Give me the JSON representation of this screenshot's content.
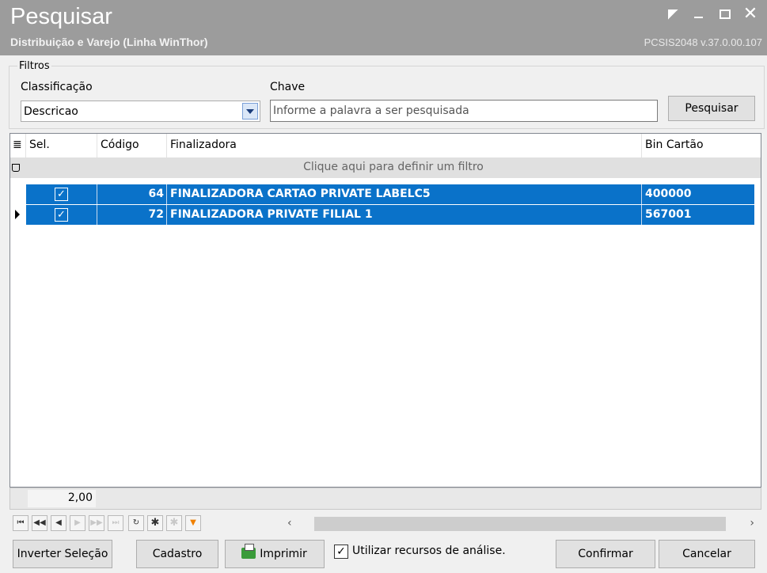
{
  "window": {
    "title": "Pesquisar",
    "subtitle": "Distribuição e Varejo (Linha WinThor)",
    "version": "PCSIS2048  v.37.0.00.107",
    "controls": [
      "restore-icon",
      "minimize-icon",
      "maximize-icon",
      "close-icon"
    ]
  },
  "filters": {
    "legend": "Filtros",
    "classificacao_label": "Classificação",
    "classificacao_value": "Descricao",
    "chave_label": "Chave",
    "chave_placeholder": "Informe a palavra a ser pesquisada",
    "search_button": "Pesquisar"
  },
  "grid": {
    "columns": [
      "Sel.",
      "Código",
      "Finalizadora",
      "Bin Cartão"
    ],
    "filter_hint": "Clique aqui para definir um filtro",
    "rows": [
      {
        "selected": true,
        "codigo": "64",
        "finalizadora": "FINALIZADORA CARTAO PRIVATE LABELC5",
        "bin": "400000",
        "current": false
      },
      {
        "selected": true,
        "codigo": "72",
        "finalizadora": "FINALIZADORA PRIVATE FILIAL 1",
        "bin": "567001",
        "current": true
      }
    ],
    "summary_value": "2,00"
  },
  "navigator": {
    "buttons": [
      "first-icon",
      "prev-page-icon",
      "prev-icon",
      "next-icon",
      "next-page-icon",
      "last-icon",
      "refresh-icon",
      "insert-icon",
      "delete-icon",
      "filter-icon"
    ]
  },
  "footer": {
    "invert_button": "Inverter Seleção",
    "cadastro_button": "Cadastro",
    "imprimir_button": "Imprimir",
    "analysis_label": "Utilizar recursos de análise.",
    "analysis_checked": true,
    "confirm_button": "Confirmar",
    "cancel_button": "Cancelar"
  },
  "colors": {
    "titlebar": "#9c9c9c",
    "selection": "#0a72c9"
  }
}
